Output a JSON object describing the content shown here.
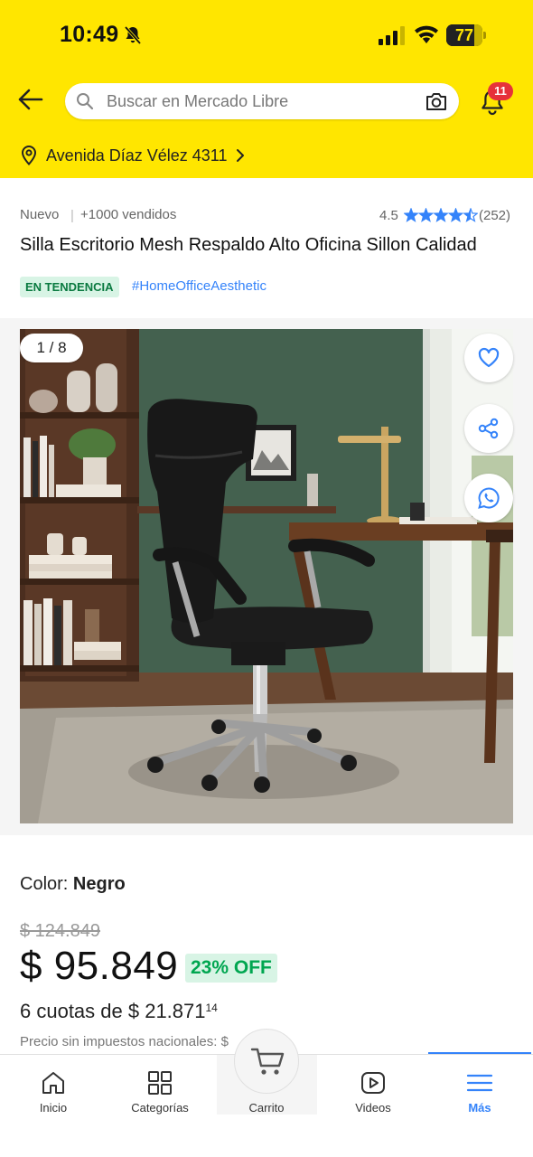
{
  "status_bar": {
    "time": "10:49",
    "battery": "77",
    "battery_level": 0.77
  },
  "search": {
    "placeholder": "Buscar en Mercado Libre",
    "notifications_count": "11"
  },
  "location": {
    "address": "Avenida Díaz Vélez 4311"
  },
  "product": {
    "condition": "Nuevo",
    "separator": "|",
    "sold": "+1000 vendidos",
    "rating": "4.5",
    "rating_value": 4.5,
    "reviews": "(252)",
    "title": "Silla Escritorio Mesh Respaldo Alto Oficina Sillon Calidad",
    "trend_badge": "EN TENDENCIA",
    "hashtag": "#HomeOfficeAesthetic"
  },
  "gallery": {
    "counter": "1 / 8"
  },
  "pricing": {
    "color_label": "Color:",
    "color_value": "Negro",
    "old_price": "$ 124.849",
    "price": "$ 95.849",
    "discount": "23% OFF",
    "installments_text": "6 cuotas de $ 21.871",
    "installments_cents": "14",
    "tax_note": "Precio sin impuestos nacionales: $"
  },
  "bottom_nav": {
    "items": [
      {
        "label": "Inicio",
        "icon": "home-icon"
      },
      {
        "label": "Categorías",
        "icon": "grid-icon"
      },
      {
        "label": "Carrito",
        "icon": "cart-icon"
      },
      {
        "label": "Videos",
        "icon": "play-icon"
      },
      {
        "label": "Más",
        "icon": "menu-icon"
      }
    ],
    "active": "Más"
  },
  "colors": {
    "brand_yellow": "#ffe600",
    "accent_blue": "#3483fa",
    "success_green": "#00a650",
    "badge_red": "#e6313a"
  }
}
